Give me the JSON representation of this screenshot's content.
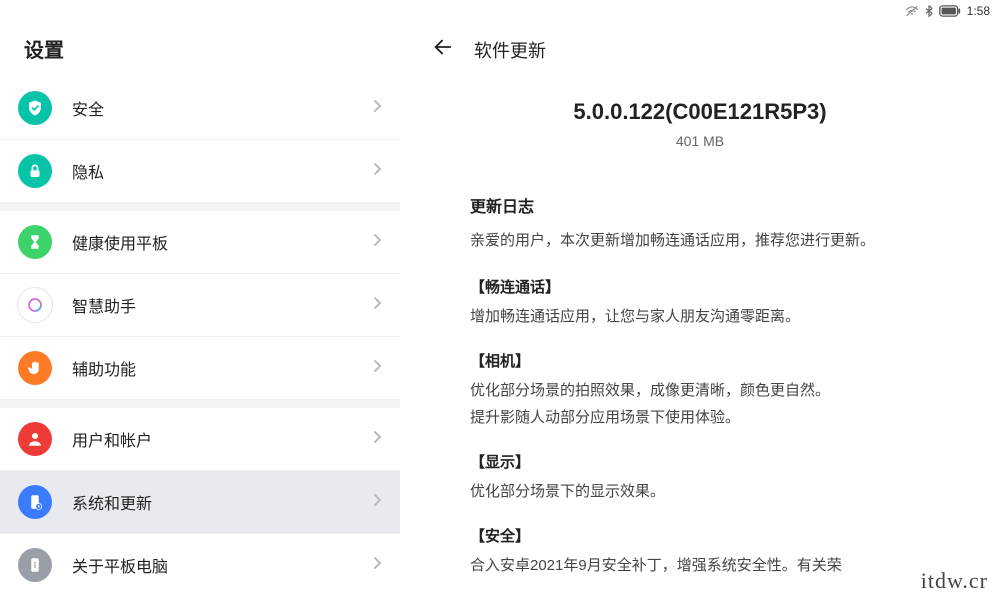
{
  "status": {
    "time": "1:58"
  },
  "settings_title": "设置",
  "sidebar": {
    "items": [
      {
        "label": "安全",
        "icon": "shield-check-icon",
        "bg": "#07c4a9",
        "fg": "#fff"
      },
      {
        "label": "隐私",
        "icon": "lock-icon",
        "bg": "#07c4a9",
        "fg": "#fff"
      },
      {
        "label": "健康使用平板",
        "icon": "hourglass-icon",
        "bg": "#3dd26a",
        "fg": "#fff"
      },
      {
        "label": "智慧助手",
        "icon": "assistant-ring-icon",
        "bg": "#ffffff",
        "fg": "#c96bd6",
        "ring": true
      },
      {
        "label": "辅助功能",
        "icon": "hand-icon",
        "bg": "#ff7a26",
        "fg": "#fff"
      },
      {
        "label": "用户和帐户",
        "icon": "person-icon",
        "bg": "#ef3b36",
        "fg": "#fff"
      },
      {
        "label": "系统和更新",
        "icon": "phone-gear-icon",
        "bg": "#3a7bff",
        "fg": "#fff",
        "active": true
      },
      {
        "label": "关于平板电脑",
        "icon": "phone-info-icon",
        "bg": "#9a9ea6",
        "fg": "#fff"
      }
    ]
  },
  "update": {
    "page_title": "软件更新",
    "version": "5.0.0.122(C00E121R5P3)",
    "size": "401 MB",
    "changelog_heading": "更新日志",
    "intro": "亲爱的用户，本次更新增加畅连通话应用，推荐您进行更新。",
    "sections": [
      {
        "title": "【畅连通话】",
        "body": "增加畅连通话应用，让您与家人朋友沟通零距离。"
      },
      {
        "title": "【相机】",
        "body": "优化部分场景的拍照效果，成像更清晰，颜色更自然。\n提升影随人动部分应用场景下使用体验。"
      },
      {
        "title": "【显示】",
        "body": "优化部分场景下的显示效果。"
      },
      {
        "title": "【安全】",
        "body": "合入安卓2021年9月安全补丁，增强系统安全性。有关荣"
      }
    ]
  },
  "watermark": "itdw.cr"
}
